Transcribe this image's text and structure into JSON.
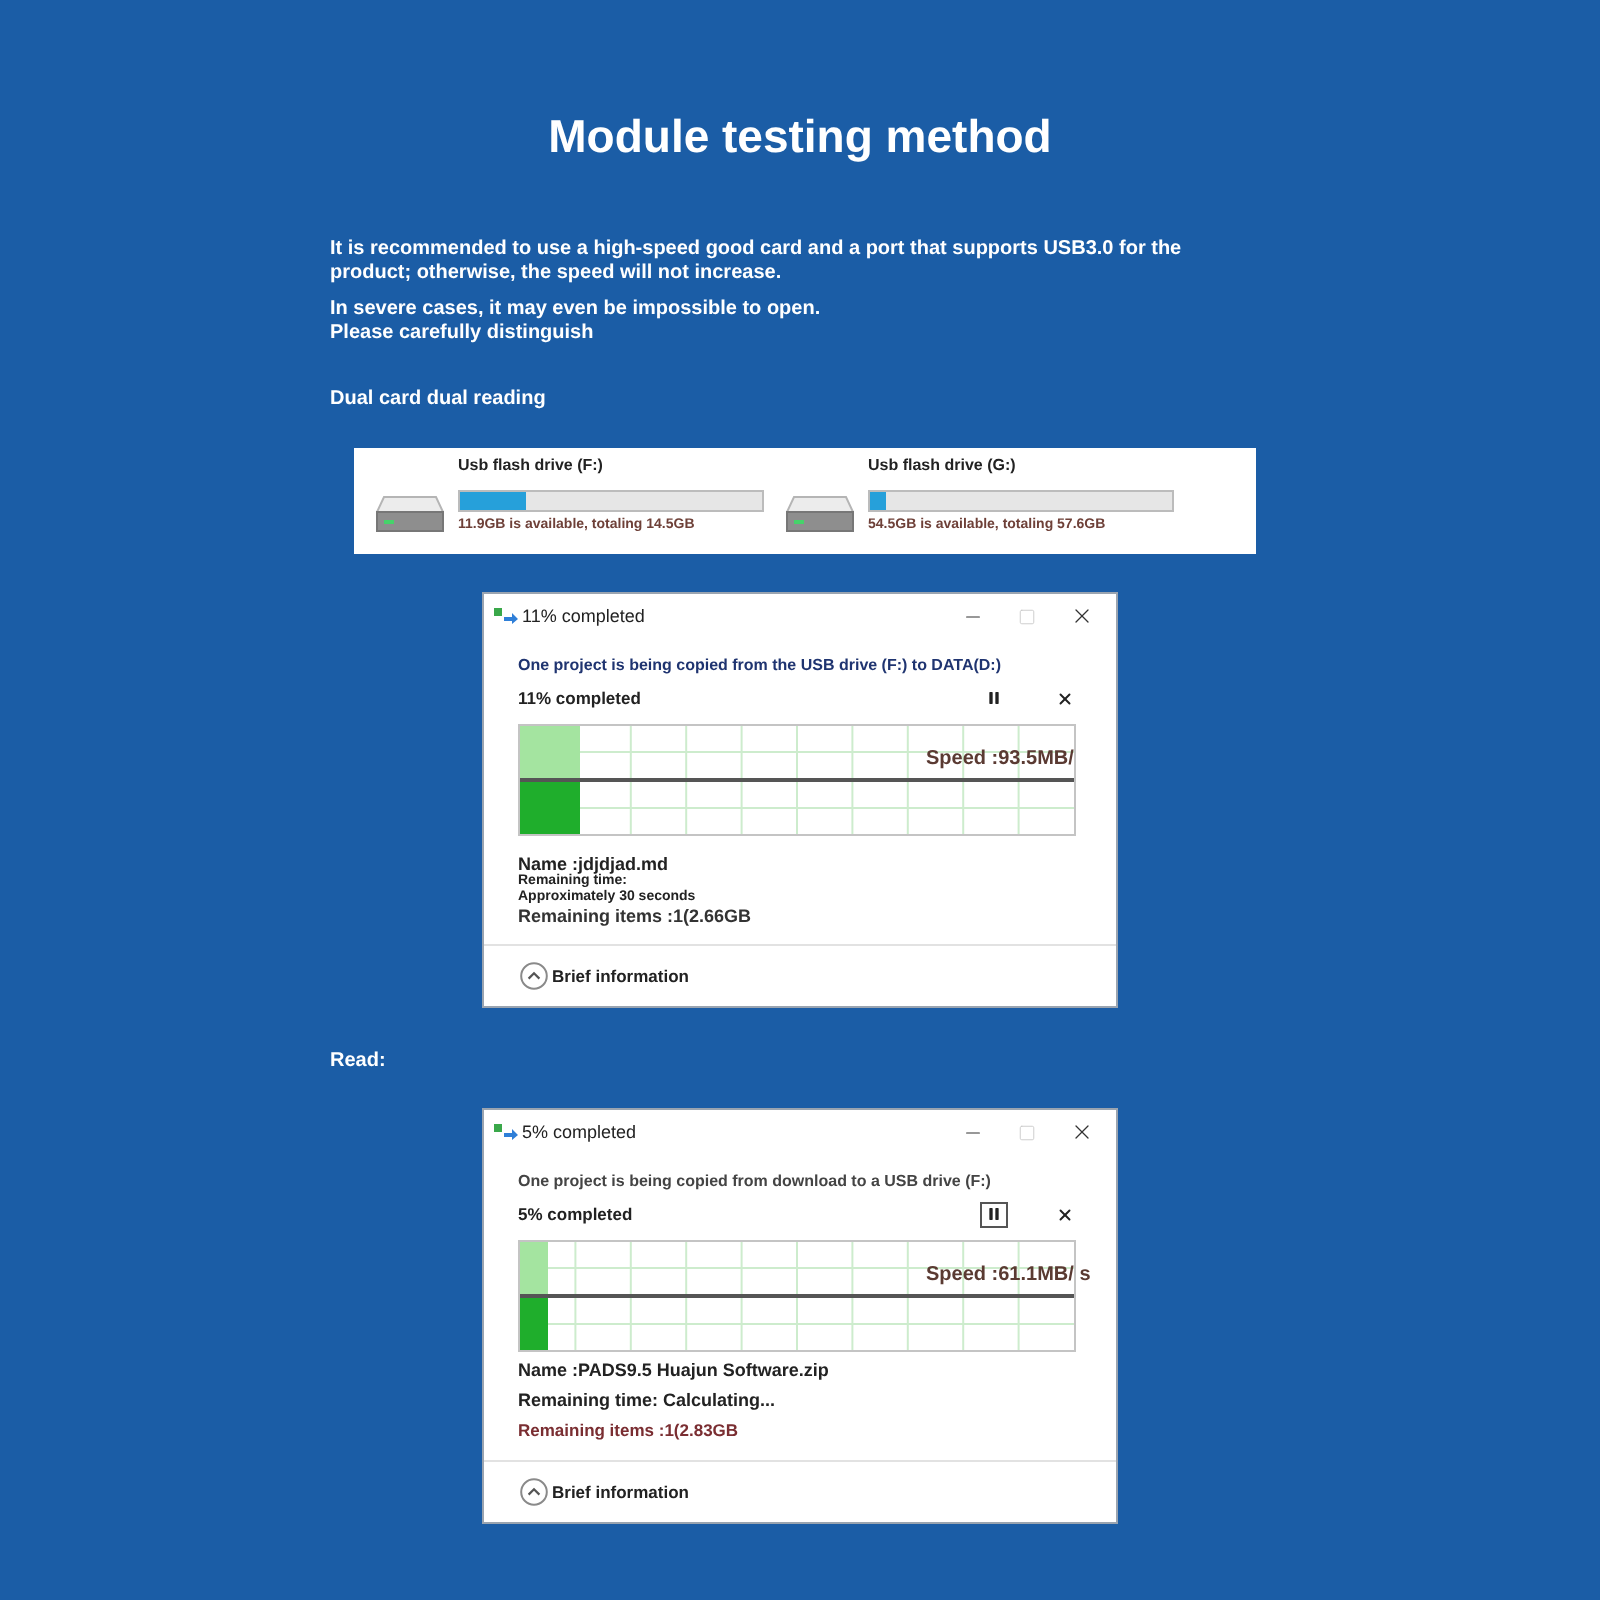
{
  "title": "Module testing method",
  "intro": "It is recommended to use a high-speed good card and a port that supports USB3.0 for the product; otherwise, the speed will not increase.",
  "warning_lines": [
    "In severe cases, it may even be impossible to open.",
    "Please carefully distinguish"
  ],
  "sections": [
    {
      "heading": "Dual card dual reading",
      "drives": [
        {
          "label": "Usb flash drive (F:)",
          "level": 0.22,
          "capacity": "11.9GB is available, totaling 14.5GB"
        },
        {
          "label": "Usb flash drive (G:)",
          "level": 0.05,
          "capacity": "54.5GB is available, totaling 57.6GB"
        }
      ],
      "dialog": {
        "window_title": "11% completed",
        "maximize_disabled": true,
        "description": {
          "kind": "accent",
          "text": "One project is being copied from the USB drive (F:) to DATA(D:)"
        },
        "status": "11% completed",
        "pause_focused": false,
        "level": 0.11,
        "speed": "Speed :93.5MB/",
        "details": [
          {
            "kind": "title",
            "text": "Name :jdjdjad.md"
          },
          {
            "kind": "note",
            "text": "Remaining time:"
          },
          {
            "kind": "note",
            "text": "Approximately 30 seconds"
          },
          {
            "kind": "summary",
            "text": "Remaining items :1(2.66GB"
          }
        ],
        "toggle": "Brief information"
      }
    },
    {
      "heading": "Read:",
      "dialog": {
        "window_title": "5% completed",
        "maximize_disabled": true,
        "description": {
          "kind": "plain",
          "text": "One project is being copied from download to a USB drive (F:)"
        },
        "status": "5% completed",
        "pause_focused": true,
        "level": 0.05,
        "speed": "Speed :61.1MB/ s",
        "details": [
          {
            "kind": "line",
            "text": "Name :PADS9.5 Huajun Software.zip"
          },
          {
            "kind": "line",
            "text": "Remaining time: Calculating..."
          },
          {
            "kind": "alert",
            "text": "Remaining items :1(2.83GB"
          }
        ],
        "toggle": "Brief information"
      }
    }
  ]
}
